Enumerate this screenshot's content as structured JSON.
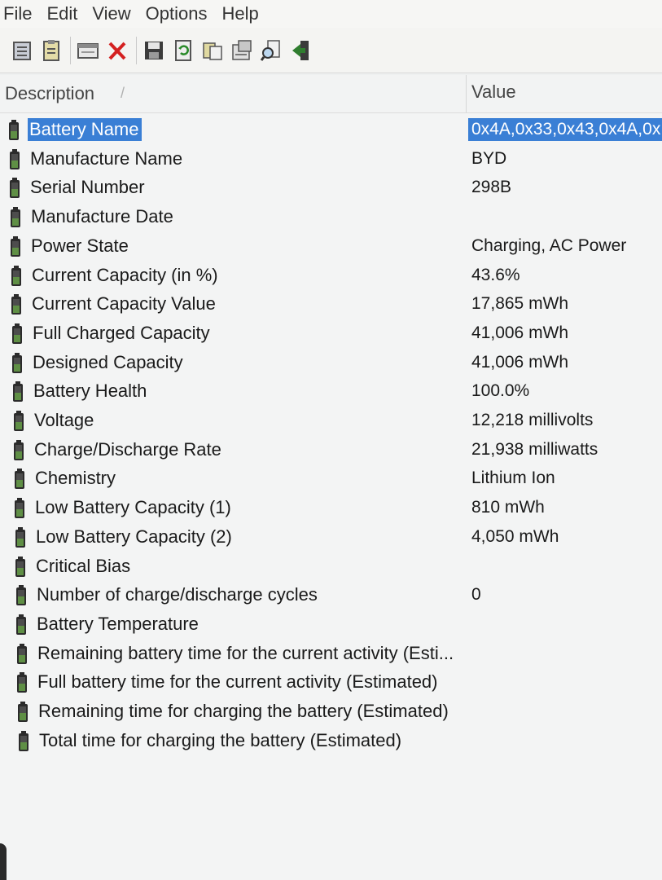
{
  "menu": [
    "File",
    "Edit",
    "View",
    "Options",
    "Help"
  ],
  "toolbar": [
    {
      "icon": "properties-icon"
    },
    {
      "icon": "clipboard-icon"
    },
    {
      "icon": "window-icon"
    },
    {
      "icon": "close-x-icon"
    },
    {
      "icon": "save-icon"
    },
    {
      "icon": "refresh-icon"
    },
    {
      "icon": "copy-icon"
    },
    {
      "icon": "html-report-icon"
    },
    {
      "icon": "find-icon"
    },
    {
      "icon": "exit-icon"
    }
  ],
  "columns": {
    "description": "Description",
    "value": "Value"
  },
  "rows": [
    {
      "description": "Battery Name",
      "value": "0x4A,0x33,0x43,0x4A,0x",
      "selected": true
    },
    {
      "description": "Manufacture Name",
      "value": "BYD"
    },
    {
      "description": "Serial Number",
      "value": "298B"
    },
    {
      "description": "Manufacture Date",
      "value": ""
    },
    {
      "description": "Power State",
      "value": "Charging, AC Power"
    },
    {
      "description": "Current Capacity (in %)",
      "value": "43.6%"
    },
    {
      "description": "Current Capacity Value",
      "value": "17,865 mWh"
    },
    {
      "description": "Full Charged Capacity",
      "value": "41,006 mWh"
    },
    {
      "description": "Designed Capacity",
      "value": "41,006 mWh"
    },
    {
      "description": "Battery Health",
      "value": "100.0%"
    },
    {
      "description": "Voltage",
      "value": "12,218 millivolts"
    },
    {
      "description": "Charge/Discharge Rate",
      "value": "21,938 milliwatts"
    },
    {
      "description": "Chemistry",
      "value": "Lithium Ion"
    },
    {
      "description": "Low Battery Capacity (1)",
      "value": "810 mWh"
    },
    {
      "description": "Low Battery Capacity (2)",
      "value": "4,050 mWh"
    },
    {
      "description": "Critical Bias",
      "value": ""
    },
    {
      "description": "Number of charge/discharge cycles",
      "value": "0"
    },
    {
      "description": "Battery Temperature",
      "value": ""
    },
    {
      "description": "Remaining battery time for the current activity (Esti...",
      "value": ""
    },
    {
      "description": "Full battery time for the current activity (Estimated)",
      "value": ""
    },
    {
      "description": "Remaining time for charging the battery (Estimated)",
      "value": ""
    },
    {
      "description": "Total  time for charging the battery (Estimated)",
      "value": ""
    }
  ],
  "colors": {
    "selection": "#3a7fd5",
    "battery_icon": "#2b2b2b"
  }
}
